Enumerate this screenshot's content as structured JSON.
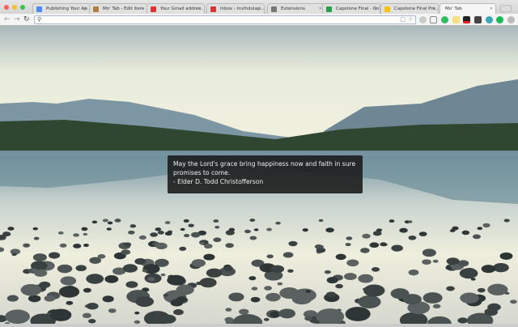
{
  "browser": {
    "tabs": [
      {
        "title": "Publishing Your Ap...",
        "icon": "chrome-icon",
        "color": "#4a8af4"
      },
      {
        "title": "Mo' Tab - Edit item",
        "icon": "extension-item-icon",
        "color": "#b08040"
      },
      {
        "title": "Your Gmail addres...",
        "icon": "gmail-icon",
        "color": "#d33"
      },
      {
        "title": "Inbox - truthdulap...",
        "icon": "gmail-icon",
        "color": "#d33"
      },
      {
        "title": "Extensions",
        "icon": "puzzle-icon",
        "color": "#777"
      },
      {
        "title": "Capstone Final - Go...",
        "icon": "drive-icon",
        "color": "#2a9d4a"
      },
      {
        "title": "Capstone Final Pre...",
        "icon": "slides-icon",
        "color": "#f4c20d"
      },
      {
        "title": "Mo' Tab",
        "icon": "",
        "color": ""
      }
    ],
    "address": {
      "value": "",
      "placeholder": ""
    }
  },
  "quote": {
    "text": "May the Lord's grace bring happiness now and faith in sure promises to come.",
    "author": "- Elder D. Todd Christofferson"
  }
}
